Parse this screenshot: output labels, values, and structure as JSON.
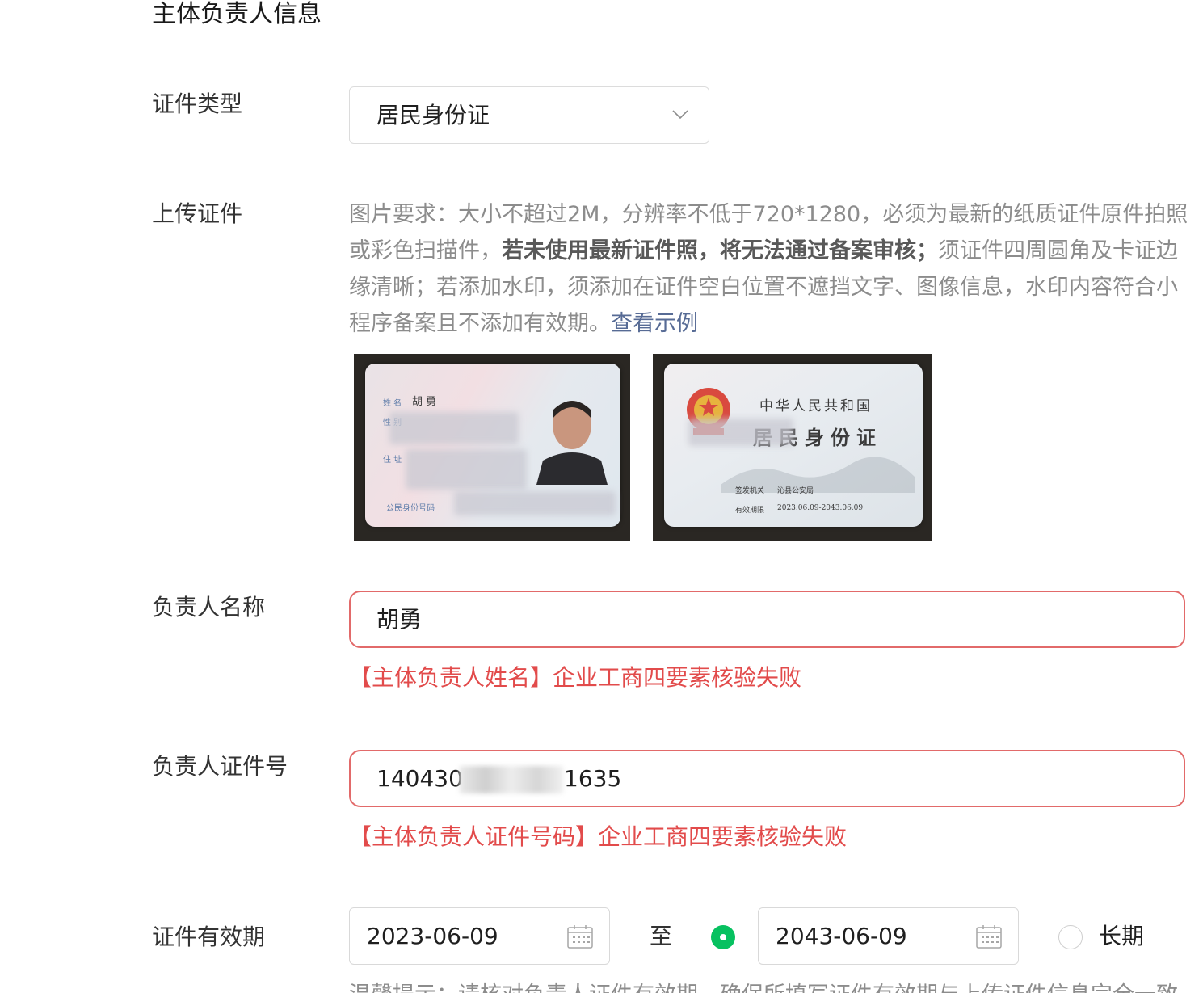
{
  "section": {
    "title": "主体负责人信息"
  },
  "doc_type": {
    "label": "证件类型",
    "selected": "居民身份证"
  },
  "upload": {
    "label": "上传证件",
    "desc_part1": "图片要求：大小不超过2M，分辨率不低于720*1280，必须为最新的纸质证件原件拍照或彩色扫描件，",
    "desc_bold": "若未使用最新证件照，将无法通过备案审核；",
    "desc_part2": "须证件四周圆角及卡证边缘清晰；若添加水印，须添加在证件空白位置不遮挡文字、图像信息，水印内容符合小程序备案且不添加有效期。",
    "example_link": "查看示例",
    "front_card": {
      "name_label": "姓 名",
      "name": "胡 勇",
      "gender_label": "性 别",
      "address_label": "住 址",
      "id_label": "公民身份号码"
    },
    "back_card": {
      "country": "中华人民共和国",
      "title": "居民身份证",
      "authority_label": "签发机关",
      "authority": "沁县公安局",
      "validity_label": "有效期限",
      "validity": "2023.06.09-2043.06.09"
    }
  },
  "person_name": {
    "label": "负责人名称",
    "value": "胡勇",
    "error": "【主体负责人姓名】企业工商四要素核验失败"
  },
  "person_id": {
    "label": "负责人证件号",
    "value_prefix": "140430",
    "value_suffix": "1635",
    "error": "【主体负责人证件号码】企业工商四要素核验失败"
  },
  "validity": {
    "label": "证件有效期",
    "start": "2023-06-09",
    "separator": "至",
    "end": "2043-06-09",
    "end_selected": true,
    "long_term_label": "长期",
    "long_term_selected": false,
    "tip": "温馨提示：请核对负责人证件有效期，确保所填写证件有效期与上传证件信息完全一致"
  },
  "colors": {
    "error": "#e24b4b",
    "link": "#576b95",
    "radio_active": "#07c160"
  }
}
